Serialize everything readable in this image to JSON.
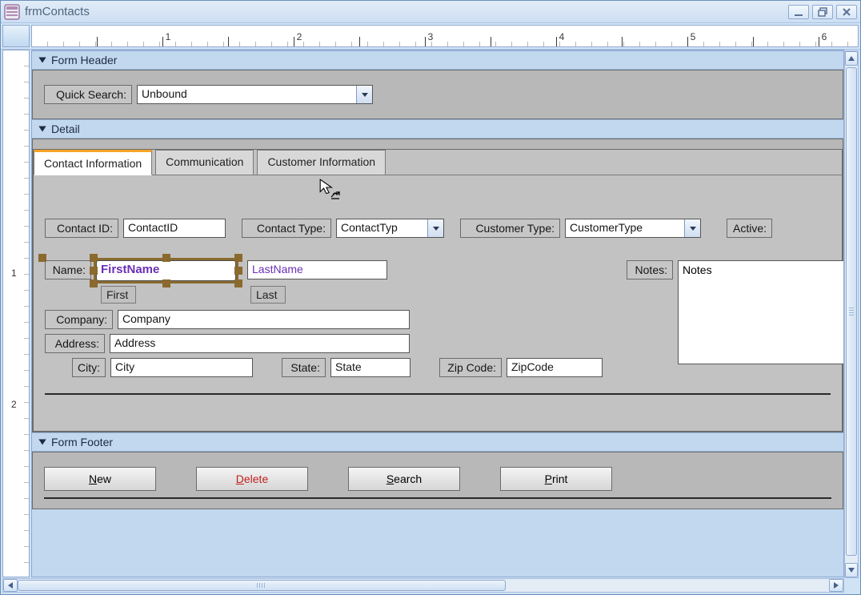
{
  "window": {
    "title": "frmContacts"
  },
  "ruler": {
    "numbers": [
      "1",
      "2",
      "3",
      "4",
      "5",
      "6"
    ],
    "vnumbers": [
      "1",
      "2"
    ]
  },
  "sections": {
    "header": "Form Header",
    "detail": "Detail",
    "footer": "Form Footer"
  },
  "quicksearch": {
    "label": "Quick Search:",
    "value": "Unbound"
  },
  "tabs": [
    {
      "label": "Contact Information",
      "active": true
    },
    {
      "label": "Communication",
      "active": false
    },
    {
      "label": "Customer Information",
      "active": false
    }
  ],
  "fields": {
    "contact_id": {
      "label": "Contact ID:",
      "value": "ContactID"
    },
    "contact_type": {
      "label": "Contact Type:",
      "value": "ContactTyp"
    },
    "customer_type": {
      "label": "Customer Type:",
      "value": "CustomerType"
    },
    "active": {
      "label": "Active:"
    },
    "name": {
      "label": "Name:",
      "first_value": "FirstName",
      "first_sub": "First",
      "last_value": "LastName",
      "last_sub": "Last"
    },
    "company": {
      "label": "Company:",
      "value": "Company"
    },
    "address": {
      "label": "Address:",
      "value": "Address"
    },
    "city": {
      "label": "City:",
      "value": "City"
    },
    "state": {
      "label": "State:",
      "value": "State"
    },
    "zip": {
      "label": "Zip Code:",
      "value": "ZipCode"
    },
    "notes": {
      "label": "Notes:",
      "value": "Notes"
    }
  },
  "footer_buttons": {
    "new": "New",
    "delete": "Delete",
    "search": "Search",
    "print": "Print"
  }
}
